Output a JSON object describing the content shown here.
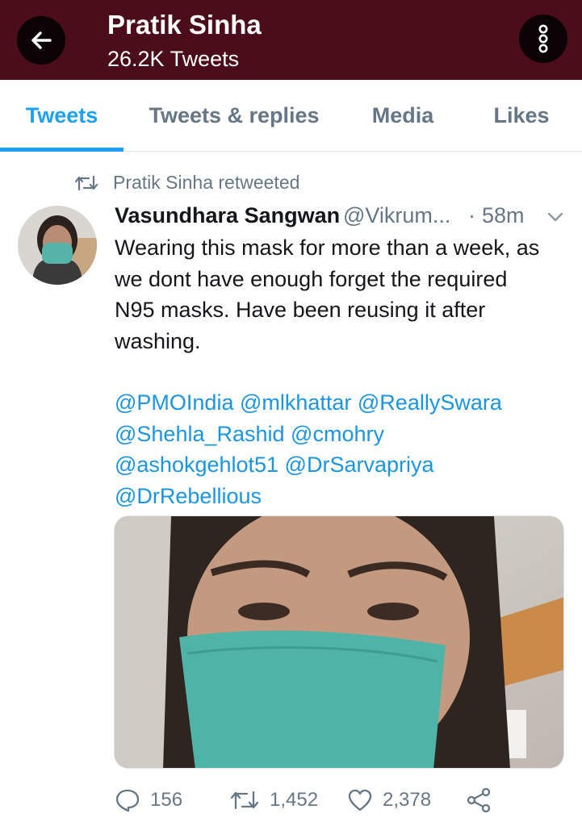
{
  "header": {
    "title": "Pratik Sinha",
    "subtitle": "26.2K Tweets",
    "back_icon": "arrow-left-icon",
    "more_icon": "more-vertical-icon",
    "background": "#4a0d19"
  },
  "tabs": [
    {
      "label": "Tweets",
      "active": true
    },
    {
      "label": "Tweets & replies",
      "active": false
    },
    {
      "label": "Media",
      "active": false
    },
    {
      "label": "Likes",
      "active": false
    }
  ],
  "tweet": {
    "retweet_label": "Pratik Sinha retweeted",
    "author_name": "Vasundhara Sangwan",
    "author_handle": "@Vikrum...",
    "separator": "·",
    "time": "58m",
    "text_lines": [
      "Wearing this mask for more than a week, as",
      "we dont have enough forget the required",
      "N95 masks. Have been reusing it after",
      "washing."
    ],
    "mention_lines": [
      "@PMOIndia @mlkhattar @ReallySwara",
      "@Shehla_Rashid @cmohry",
      "@ashokgehlot51 @DrSarvapriya",
      "@DrRebellious"
    ],
    "replies": "156",
    "retweets": "1,452",
    "likes": "2,378"
  },
  "colors": {
    "accent": "#1da1f2",
    "mention": "#1b95e0",
    "muted": "#657786"
  }
}
